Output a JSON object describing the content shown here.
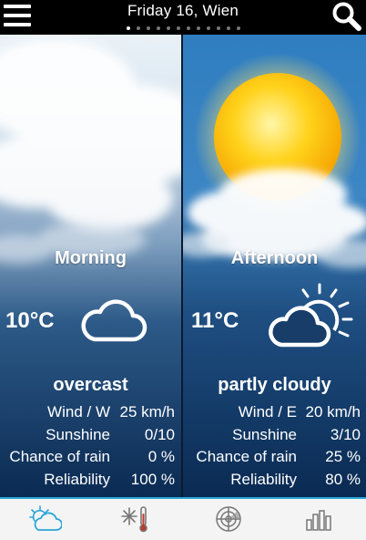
{
  "header": {
    "title": "Friday 16, Wien",
    "page_count": 12,
    "active_page": 0
  },
  "panels": [
    {
      "period": "Morning",
      "temperature": "10°C",
      "condition": "overcast",
      "icon": "cloud-icon",
      "stats": [
        {
          "label": "Wind / W",
          "value": "25 km/h"
        },
        {
          "label": "Sunshine",
          "value": "0/10"
        },
        {
          "label": "Chance of rain",
          "value": "0 %"
        },
        {
          "label": "Reliability",
          "value": "100 %"
        }
      ]
    },
    {
      "period": "Afternoon",
      "temperature": "11°C",
      "condition": "partly cloudy",
      "icon": "partly-cloudy-icon",
      "stats": [
        {
          "label": "Wind / E",
          "value": "20 km/h"
        },
        {
          "label": "Sunshine",
          "value": "3/10"
        },
        {
          "label": "Chance of rain",
          "value": "25 %"
        },
        {
          "label": "Reliability",
          "value": "80 %"
        }
      ]
    }
  ],
  "tabs": [
    {
      "icon": "weather-forecast-icon",
      "active": true
    },
    {
      "icon": "snow-thermometer-icon",
      "active": false
    },
    {
      "icon": "radar-icon",
      "active": false
    },
    {
      "icon": "bar-chart-icon",
      "active": false
    }
  ],
  "colors": {
    "accent": "#2aa7d8",
    "sky_dark": "#0c2c54",
    "sun": "#ffd21a"
  }
}
